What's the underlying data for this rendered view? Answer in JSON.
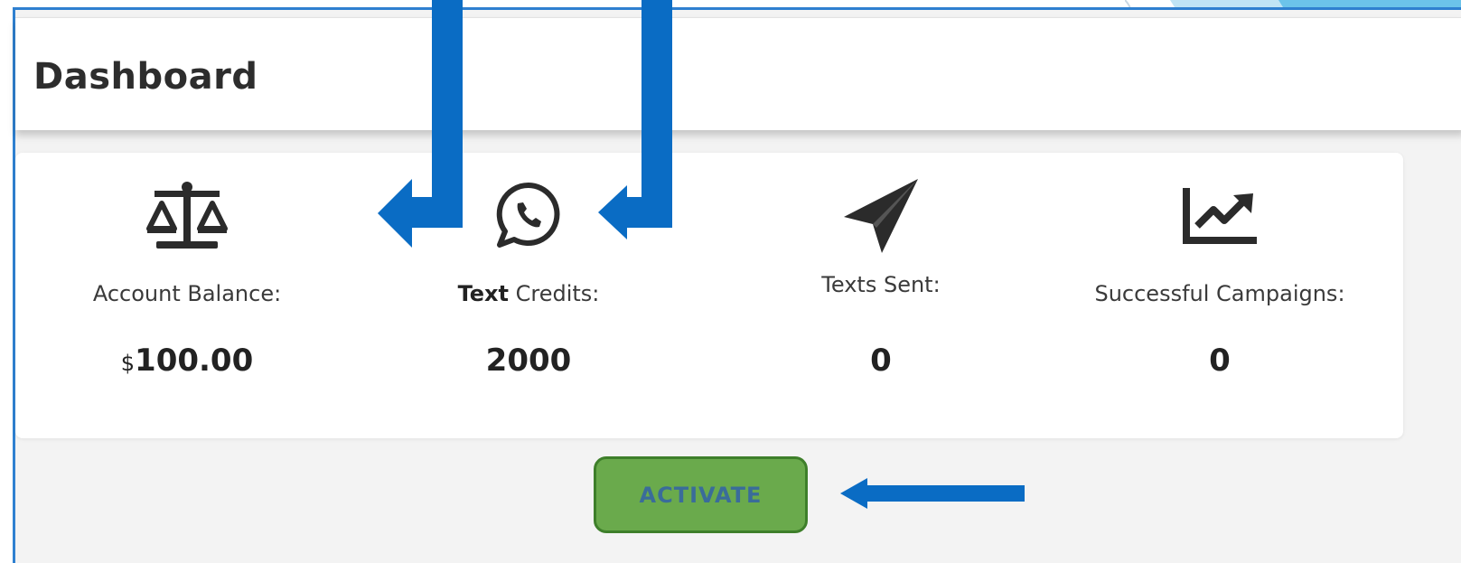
{
  "header": {
    "title": "Dashboard"
  },
  "stats": [
    {
      "icon": "balance-scale-icon",
      "label": "Account Balance:",
      "value_prefix": "$",
      "value": "100.00"
    },
    {
      "icon": "whatsapp-icon",
      "label_bold": "Text",
      "label": " Credits:",
      "value": "2000"
    },
    {
      "icon": "paper-plane-icon",
      "label": "Texts Sent:",
      "value": "0"
    },
    {
      "icon": "line-chart-icon",
      "label": "Successful Campaigns:",
      "value": "0"
    }
  ],
  "actions": {
    "activate_label": "ACTIVATE"
  },
  "colors": {
    "frame_border": "#2f80d0",
    "arrow": "#0a6cc4",
    "button_bg": "#6aaa4c",
    "button_border": "#3e7f2a",
    "button_text": "#3a6c9a"
  }
}
